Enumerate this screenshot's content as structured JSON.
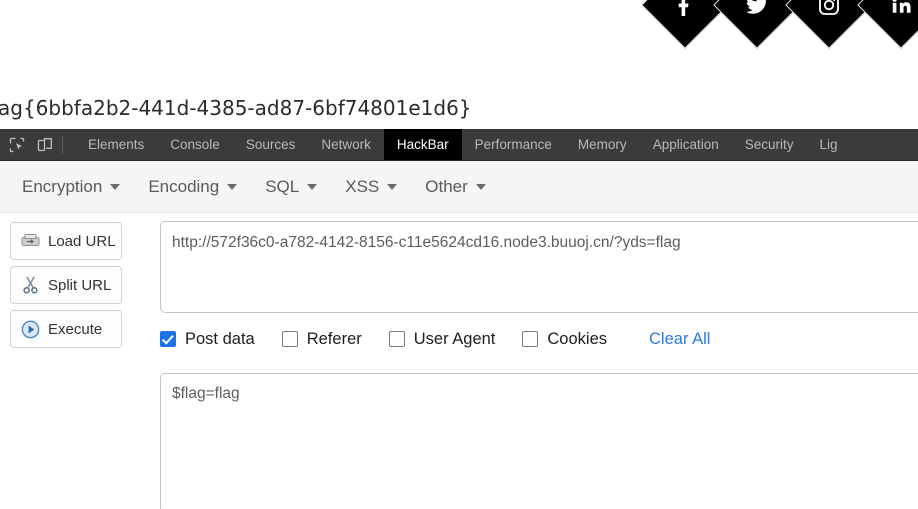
{
  "page": {
    "flag_text": "ag{6bbfa2b2-441d-4385-ad87-6bf74801e1d6}",
    "social": [
      {
        "name": "facebook-icon",
        "label": "Facebook"
      },
      {
        "name": "twitter-icon",
        "label": "Twitter"
      },
      {
        "name": "instagram-icon",
        "label": "Instagram"
      },
      {
        "name": "linkedin-icon",
        "label": "LinkedIn"
      }
    ]
  },
  "devtools": {
    "inspect_icon": "inspect-element-icon",
    "device_icon": "device-toolbar-icon",
    "tabs": [
      {
        "label": "Elements",
        "active": false
      },
      {
        "label": "Console",
        "active": false
      },
      {
        "label": "Sources",
        "active": false
      },
      {
        "label": "Network",
        "active": false
      },
      {
        "label": "HackBar",
        "active": true
      },
      {
        "label": "Performance",
        "active": false
      },
      {
        "label": "Memory",
        "active": false
      },
      {
        "label": "Application",
        "active": false
      },
      {
        "label": "Security",
        "active": false
      },
      {
        "label": "Lig",
        "active": false
      }
    ],
    "active_tab": "HackBar",
    "bar_bg": "#3b3b3b",
    "active_tab_bg": "#000000"
  },
  "hackbar": {
    "menu": [
      {
        "label": "Encryption"
      },
      {
        "label": "Encoding"
      },
      {
        "label": "SQL"
      },
      {
        "label": "XSS"
      },
      {
        "label": "Other"
      }
    ],
    "buttons": [
      {
        "label": "Load URL",
        "icon": "load-url-icon"
      },
      {
        "label": "Split URL",
        "icon": "scissors-icon"
      },
      {
        "label": "Execute",
        "icon": "play-icon"
      }
    ],
    "url_value": "http://572f36c0-a782-4142-8156-c11e5624cd16.node3.buuoj.cn/?yds=flag",
    "url_placeholder": "",
    "options": [
      {
        "label": "Post data",
        "checked": true
      },
      {
        "label": "Referer",
        "checked": false
      },
      {
        "label": "User Agent",
        "checked": false
      },
      {
        "label": "Cookies",
        "checked": false
      }
    ],
    "clear_all_label": "Clear All",
    "clear_all_color": "#2a7ae2",
    "post_data_value": "$flag=flag",
    "post_data_placeholder": "",
    "accent_color": "#1a73e8",
    "menubar_bg": "#f5f5f5"
  }
}
